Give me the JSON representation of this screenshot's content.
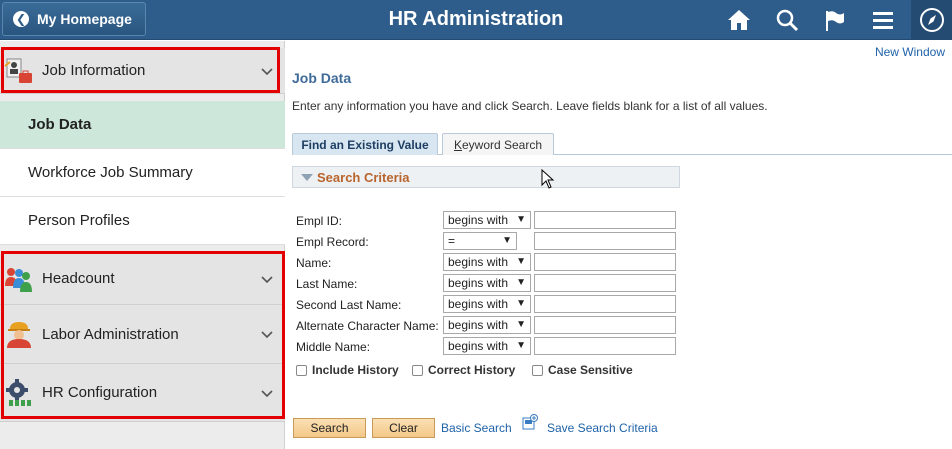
{
  "header": {
    "home_label": "My Homepage",
    "title": "HR Administration",
    "icons": [
      "home-icon",
      "search-icon",
      "flag-icon",
      "menu-icon",
      "compass-icon"
    ]
  },
  "sidebar": {
    "sections": [
      {
        "label": "Job Information",
        "icon": "job-information-icon"
      },
      {
        "label": "Headcount",
        "icon": "people-icon"
      },
      {
        "label": "Labor Administration",
        "icon": "labor-icon"
      },
      {
        "label": "HR Configuration",
        "icon": "gear-icon"
      }
    ],
    "items": [
      {
        "label": "Job Data",
        "active": true
      },
      {
        "label": "Workforce Job Summary",
        "active": false
      },
      {
        "label": "Person Profiles",
        "active": false
      }
    ]
  },
  "content": {
    "new_window": "New Window",
    "page_title": "Job Data",
    "instructions": "Enter any information you have and click Search. Leave fields blank for a list of all values.",
    "tabs": [
      "Find an Existing Value",
      "Keyword Search"
    ],
    "criteria_label": "Search Criteria",
    "fields": [
      {
        "label": "Empl ID:",
        "operator": "begins with",
        "value": ""
      },
      {
        "label": "Empl Record:",
        "operator": "=",
        "value": ""
      },
      {
        "label": "Name:",
        "operator": "begins with",
        "value": ""
      },
      {
        "label": "Last Name:",
        "operator": "begins with",
        "value": ""
      },
      {
        "label": "Second Last Name:",
        "operator": "begins with",
        "value": ""
      },
      {
        "label": "Alternate Character Name:",
        "operator": "begins with",
        "value": ""
      },
      {
        "label": "Middle Name:",
        "operator": "begins with",
        "value": ""
      }
    ],
    "checkboxes": [
      "Include History",
      "Correct History",
      "Case Sensitive"
    ],
    "buttons": {
      "search": "Search",
      "clear": "Clear"
    },
    "links": {
      "basic_search": "Basic Search",
      "save_criteria": "Save Search Criteria"
    }
  },
  "colors": {
    "header": "#2f5d8b",
    "active_item": "#cde7da",
    "highlight_border": "#e30000",
    "link": "#1f62a8",
    "button": "#f2c888"
  }
}
